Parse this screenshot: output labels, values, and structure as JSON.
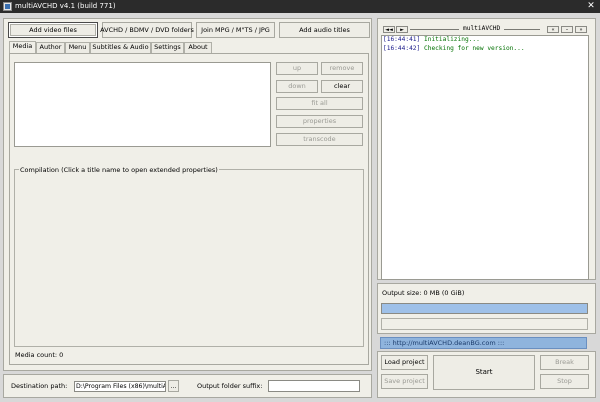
{
  "window": {
    "title": "multiAVCHD v4.1 (build 771)",
    "close_glyph": "✕"
  },
  "toolbar": {
    "add_video": "Add video files",
    "avchd": "AVCHD / BDMV / DVD folders",
    "join": "Join MPG / M\"TS / JPG",
    "audio": "Add audio titles"
  },
  "tabs": [
    "Media",
    "Author",
    "Menu",
    "Subtitles & Audio",
    "Settings",
    "About"
  ],
  "media_buttons": {
    "up": "up",
    "remove": "remove",
    "down": "down",
    "clear": "clear",
    "fit_all": "fit all",
    "properties": "properties",
    "transcode": "transcode"
  },
  "compilation_label": "Compilation (Click a title name to open extended properties)",
  "media_count": "Media count: 0",
  "destination": {
    "label": "Destination path:",
    "value": "D:\\Program Files (x86)\\multiAV",
    "browse": "..."
  },
  "suffix": {
    "label": "Output folder suffix:",
    "value": ""
  },
  "right": {
    "nav_prev_prev": "◄◄",
    "nav_next": "►",
    "header_title": "multiAVCHD",
    "ctrl_1": "«",
    "ctrl_2": "–",
    "ctrl_3": "»",
    "log": [
      {
        "time": "[16:44:41]",
        "msg": "Initializing..."
      },
      {
        "time": "[16:44:42]",
        "msg": "Checking for new version..."
      }
    ],
    "output_size": "Output size: 0 MB (0 GiB)",
    "progress": 1.0,
    "url": "::: http://multiAVCHD.deanBG.com :::",
    "load_project": "Load project",
    "save_project": "Save project",
    "start": "Start",
    "break": "Break",
    "stop": "Stop"
  },
  "colors": {
    "progress": "#9ec0e8",
    "url_bar": "#8fb4dd",
    "log_time": "#1a1a8a",
    "log_msg": "#007000"
  }
}
